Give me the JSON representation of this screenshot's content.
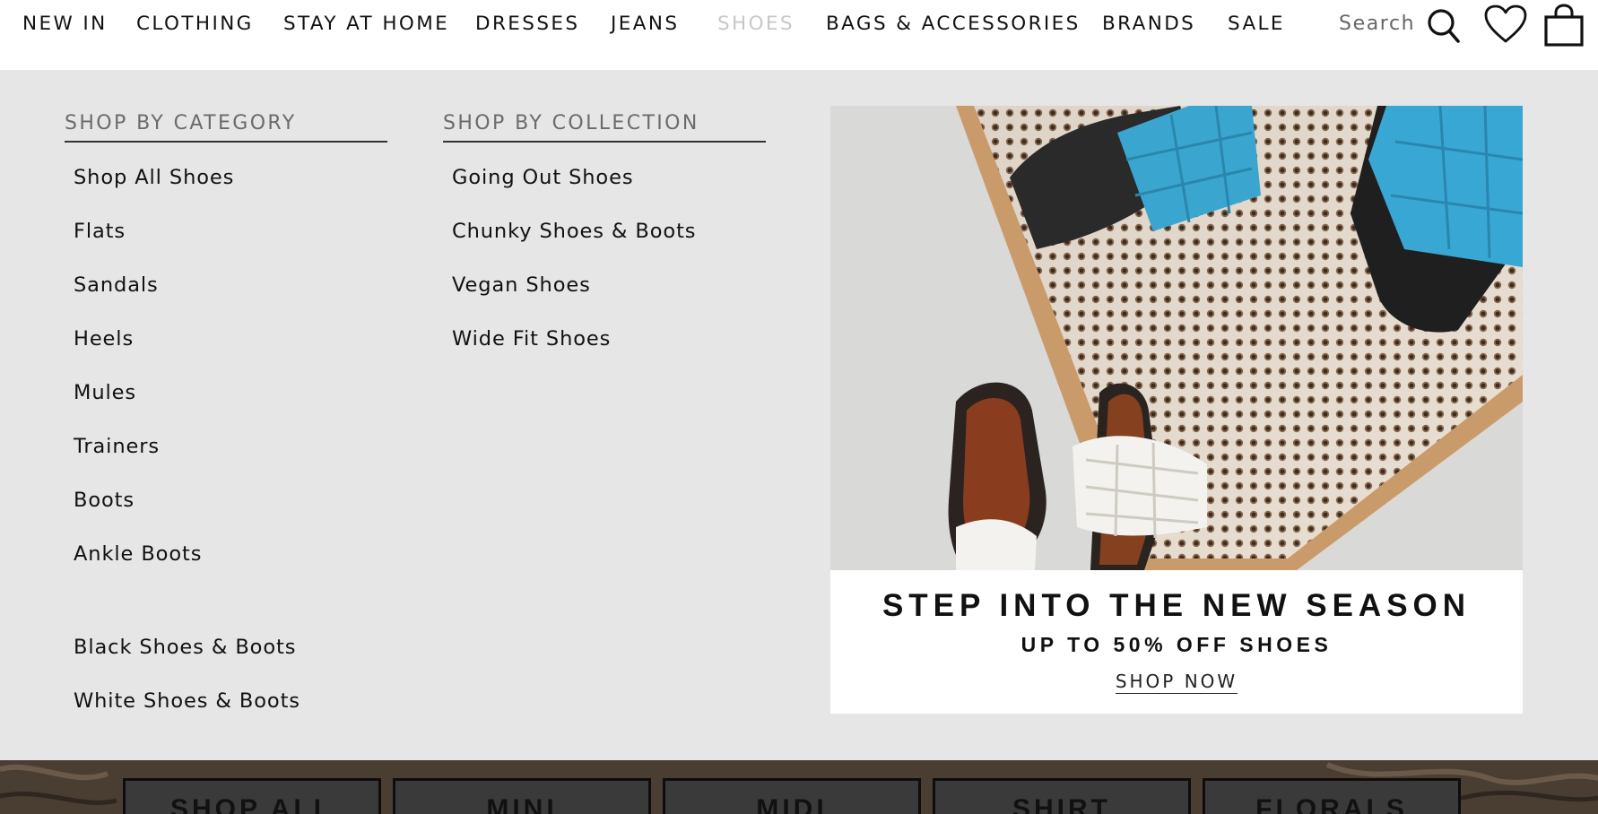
{
  "nav": {
    "items": [
      {
        "label": "NEW IN"
      },
      {
        "label": "CLOTHING"
      },
      {
        "label": "STAY AT HOME"
      },
      {
        "label": "DRESSES"
      },
      {
        "label": "JEANS"
      },
      {
        "label": "SHOES",
        "active": true
      },
      {
        "label": "BAGS & ACCESSORIES"
      },
      {
        "label": "BRANDS"
      },
      {
        "label": "SALE"
      }
    ],
    "search_label": "Search",
    "icons": [
      "search-icon",
      "heart-icon",
      "bag-icon"
    ],
    "active_color": "#c7c7c7"
  },
  "menu": {
    "category": {
      "heading": "SHOP BY CATEGORY",
      "links": [
        "Shop All Shoes",
        "Flats",
        "Sandals",
        "Heels",
        "Mules",
        "Trainers",
        "Boots",
        "Ankle Boots"
      ],
      "extra_links": [
        "Black Shoes & Boots",
        "White Shoes & Boots"
      ]
    },
    "collection": {
      "heading": "SHOP BY COLLECTION",
      "links": [
        "Going Out Shoes",
        "Chunky Shoes & Boots",
        "Vegan Shoes",
        "Wide Fit Shoes"
      ]
    },
    "background": "#e6e6e6"
  },
  "promo": {
    "title": "STEP INTO THE NEW SEASON",
    "subtitle": "UP TO 50% OFF SHOES",
    "cta": "SHOP NOW"
  },
  "categories": {
    "buttons": [
      "SHOP ALL",
      "MINI",
      "MIDI",
      "SHIRT",
      "FLORALS"
    ]
  }
}
